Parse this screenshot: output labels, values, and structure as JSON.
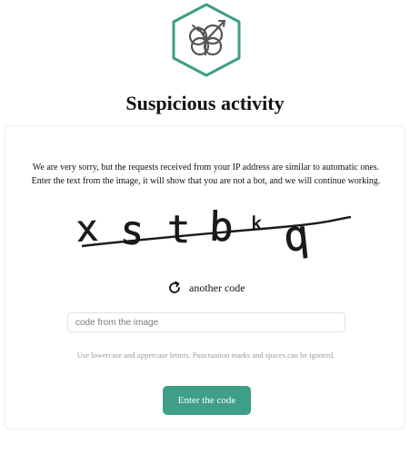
{
  "page": {
    "title": "Suspicious activity"
  },
  "logo": {
    "icon": "shield-cloud-icon",
    "accent_color": "#3f9e87"
  },
  "message": {
    "line1": "We are very sorry, but the requests received from your IP address are similar to automatic ones.",
    "line2": "Enter the text from the image, it will show that you are not a bot, and we will continue working."
  },
  "captcha": {
    "text": "xstbkq"
  },
  "refresh": {
    "label": "another code",
    "icon": "refresh-icon"
  },
  "form": {
    "code_placeholder": "code from the image",
    "code_value": "",
    "hint": "Use lowercase and uppercase letters. Punctuation marks and spaces can be ignored.",
    "submit_label": "Enter the code",
    "button_color": "#3f9e87"
  }
}
